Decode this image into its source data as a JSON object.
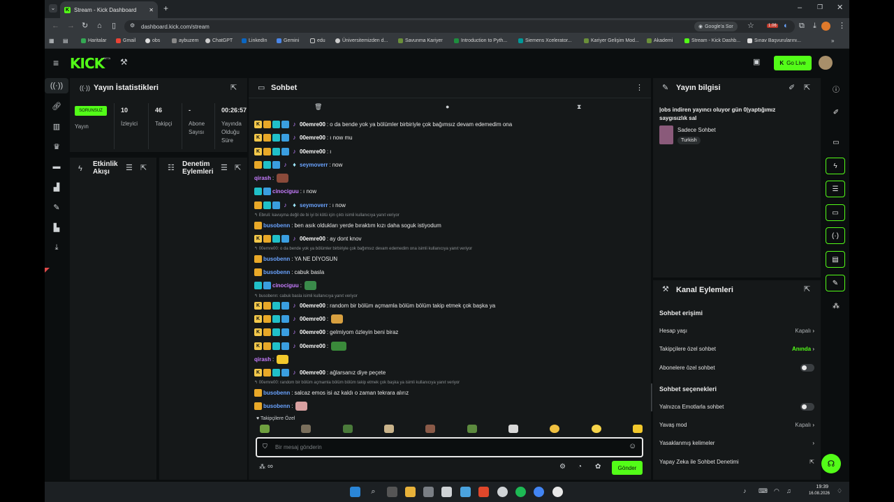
{
  "browser": {
    "tab_title": "Stream - Kick Dashboard",
    "new_tab_label": "+",
    "url": "dashboard.kick.com/stream",
    "google_label": "Google'a Sor",
    "bookmarks": [
      "Haritalar",
      "Gmail",
      "obs",
      "aybuzem",
      "ChatGPT",
      "LinkedIn",
      "Gemini",
      "edu",
      "Üniversitemizden d...",
      "Savunma Kariyer",
      "Introduction to Pyth...",
      "Siemens Xcelerator...",
      "Kariyer Gelişim Mod...",
      "Akademi",
      "Stream - Kick Dashb...",
      "Sınav Başvurularını..."
    ],
    "badge_count": "1.06"
  },
  "header": {
    "logo": "KICK",
    "logo_sup": "BETA",
    "go_live": "Go Live"
  },
  "stats": {
    "title": "Yayın İstatistikleri",
    "status_badge": "SORUNSUZ",
    "status_label": "Yayın",
    "viewers_value": "10",
    "viewers_label": "İzleyici",
    "followers_value": "46",
    "followers_label": "Takipçi",
    "subs_value": "-",
    "subs_label_1": "Abone",
    "subs_label_2": "Sayısı",
    "duration_value": "00:26:57",
    "duration_label_1": "Yayında",
    "duration_label_2": "Olduğu",
    "duration_label_3": "Süre"
  },
  "activity": {
    "title_1": "Etkinlik",
    "title_2": "Akışı"
  },
  "moderation": {
    "title_1": "Denetim",
    "title_2": "Eylemleri"
  },
  "chat": {
    "title": "Sohbet",
    "messages": [
      {
        "user": "00emre00",
        "text": "o da bende yok ya bölümler birbiriyle çok bağımsız devam edemedim ona",
        "color": "#ffffff"
      },
      {
        "user": "00emre00",
        "text": "ı now mu",
        "color": "#ffffff"
      },
      {
        "user": "00emre00",
        "text": "ı",
        "color": "#ffffff"
      },
      {
        "user": "seymoverr",
        "text": "now",
        "color": "#6aa3ff"
      },
      {
        "user": "qirash",
        "text": "",
        "color": "#c77dff"
      },
      {
        "user": "cinociguu",
        "text": "ı now",
        "color": "#c77dff"
      },
      {
        "user": "seymoverr",
        "text": "ı now",
        "color": "#6aa3ff"
      },
      {
        "user": "busobenn",
        "text": "ben asık oldukları yerde bıraktım kızı daha soguk istiyodum",
        "color": "#6aa3ff"
      },
      {
        "user": "00emre00",
        "text": "ay dont knov",
        "color": "#ffffff"
      },
      {
        "user": "busobenn",
        "text": "YA NE DİYOSUN",
        "color": "#6aa3ff"
      },
      {
        "user": "busobenn",
        "text": "cabuk basla",
        "color": "#6aa3ff"
      },
      {
        "user": "cinociguu",
        "text": "",
        "color": "#c77dff"
      },
      {
        "user": "00emre00",
        "text": "random bir bölüm açmamla bölüm bölüm takip etmek çok başka ya",
        "color": "#ffffff"
      },
      {
        "user": "00emre00",
        "text": "",
        "color": "#ffffff"
      },
      {
        "user": "00emre00",
        "text": "gelmiyom özleyin beni biraz",
        "color": "#ffffff"
      },
      {
        "user": "00emre00",
        "text": "",
        "color": "#ffffff"
      },
      {
        "user": "qirash",
        "text": "",
        "color": "#c77dff"
      },
      {
        "user": "00emre00",
        "text": "ağlarsanız diye peçete",
        "color": "#ffffff"
      },
      {
        "user": "busobenn",
        "text": "salcaz emos isi az kaldı o zaman tekrara alırız",
        "color": "#6aa3ff"
      },
      {
        "user": "busobenn",
        "text": "",
        "color": "#6aa3ff"
      }
    ],
    "replies": [
      "Ebruli: kavuşma değil de bi iyi bi kötü için çıktı isimli kullanıcıya yanıt veriyor",
      "00emre00: o da bende yok ya bölümler birbiriyle çok bağımsız devam edemedim ona isimli kullanıcıya yanıt veriyor",
      "busobenn: cabuk basla isimli kullanıcıya yanıt veriyor",
      "00emre00: random bir bölüm açmamla bölüm bölüm takip etmek çok başka ya isimli kullanıcıya yanıt veriyor"
    ],
    "followers_only_label": "Takipçilere Özel",
    "input_placeholder": "Bir mesaj gönderin",
    "send_label": "Gönder",
    "infinity": "∞"
  },
  "stream_info": {
    "title": "Yayın bilgisi",
    "stream_title": "|obs indiren yayıncı oluyor gün 0|yaptığımız saygısızlık sal",
    "category": "Sadece Sohbet",
    "language": "Turkish"
  },
  "channel_actions": {
    "title": "Kanal Eylemleri",
    "section_access": "Sohbet erişimi",
    "account_age_label": "Hesap yaşı",
    "account_age_value": "Kapalı",
    "followers_chat_label": "Takipçilere özel sohbet",
    "followers_chat_value": "Anında",
    "subscribers_chat_label": "Abonelere özel sohbet",
    "section_options": "Sohbet seçenekleri",
    "emotes_only_label": "Yalnızca Emotlarla sohbet",
    "slow_mode_label": "Yavaş mod",
    "slow_mode_value": "Kapalı",
    "banned_words_label": "Yasaklanmış kelimeler",
    "ai_moderation_label": "Yapay Zeka ile Sohbet Denetimi"
  },
  "taskbar": {
    "time": "19:39",
    "date": "16.08.2026"
  },
  "colors": {
    "accent": "#53fc18",
    "panel": "#151819",
    "bg": "#0b0e0f"
  }
}
